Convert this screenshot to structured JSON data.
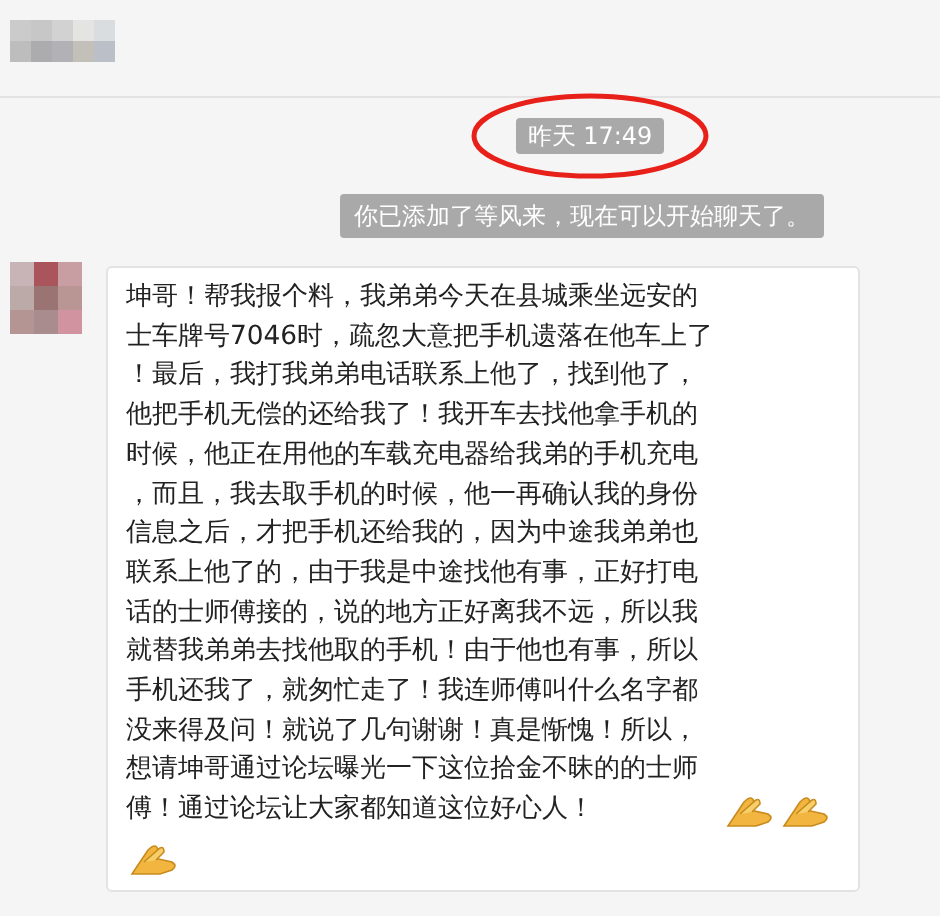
{
  "timestamp": "昨天 17:49",
  "system_notice": "你已添加了等风来，现在可以开始聊天了。",
  "messages": [
    {
      "lines": [
        "坤哥！帮我报个料，我弟弟今天在县城乘坐远安的",
        "士车牌号7046时，疏忽大意把手机遗落在他车上了",
        "！最后，我打我弟弟电话联系上他了，找到他了，",
        "他把手机无偿的还给我了！我开车去找他拿手机的",
        "时候，他正在用他的车载充电器给我弟的手机充电",
        "，而且，我去取手机的时候，他一再确认我的身份",
        "信息之后，才把手机还给我的，因为中途我弟弟也",
        "联系上他了的，由于我是中途找他有事，正好打电",
        "话的士师傅接的，说的地方正好离我不远，所以我",
        "就替我弟弟去找他取的手机！由于他也有事，所以",
        "手机还我了，就匆忙走了！我连师傅叫什么名字都",
        "没来得及问！就说了几句谢谢！真是惭愧！所以，",
        "想请坤哥通过论坛曝光一下这位拾金不昧的的士师",
        "傅！通过论坛让大家都知道这位好心人！"
      ]
    }
  ]
}
